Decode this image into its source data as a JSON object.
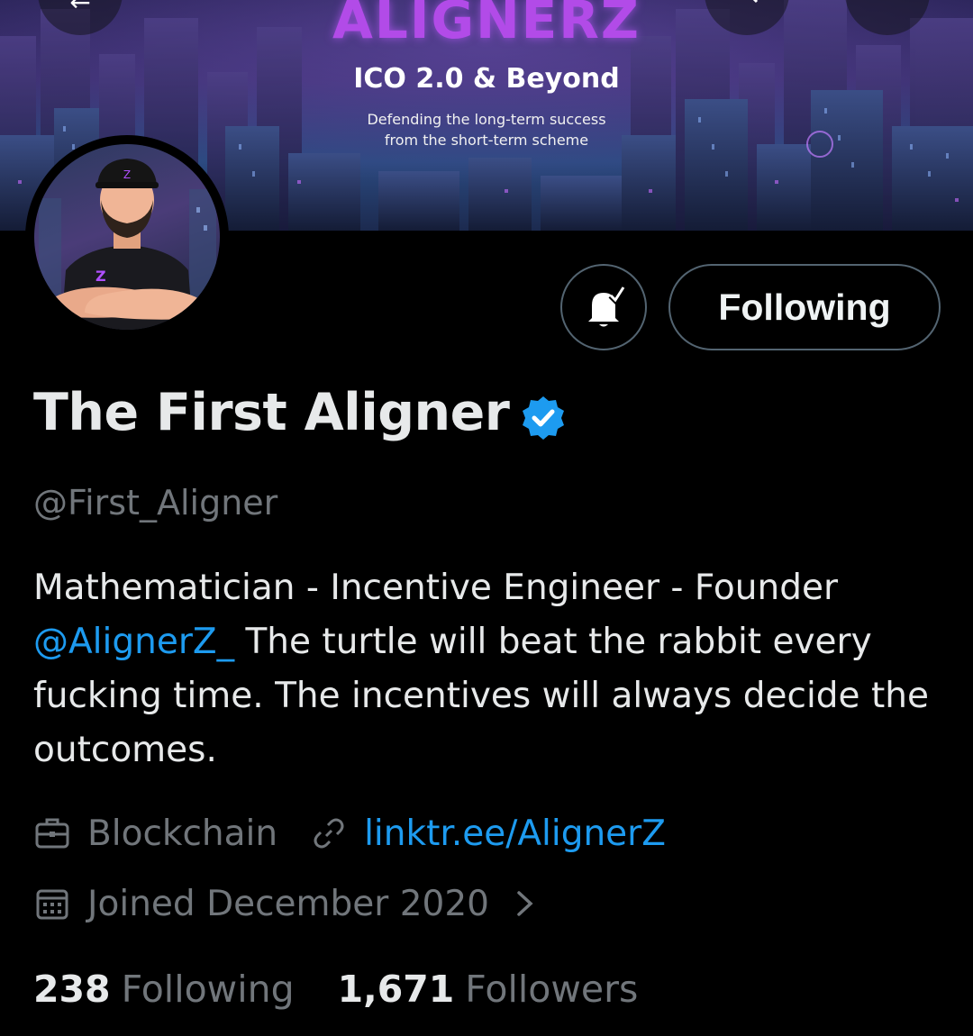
{
  "banner": {
    "logo": "ALIGNERZ",
    "tagline": "ICO 2.0 & Beyond",
    "subtitle_line1": "Defending the long-term success",
    "subtitle_line2": "from the short-term scheme"
  },
  "nav": {
    "back_icon": "arrow-left-icon",
    "search_icon": "search-icon",
    "more_icon": "more-vertical-icon"
  },
  "actions": {
    "notifications_icon": "bell-check-icon",
    "follow_label": "Following"
  },
  "profile": {
    "display_name": "The First Aligner",
    "verified": true,
    "handle": "@First_Aligner",
    "bio_prefix": "Mathematician - Incentive Engineer - Founder",
    "bio_mention": "@AlignerZ_",
    "bio_suffix": " The turtle will beat the rabbit  every fucking time. The incentives will always decide the outcomes.",
    "category": "Blockchain",
    "website": "linktr.ee/AlignerZ",
    "joined": "Joined December 2020"
  },
  "stats": {
    "following_count": "238",
    "following_label": "Following",
    "followers_count": "1,671",
    "followers_label": "Followers"
  },
  "colors": {
    "background": "#000000",
    "text_primary": "#e7e9ea",
    "text_secondary": "#71767b",
    "link": "#1d9bf0",
    "verified_badge": "#1d9bf0",
    "button_border": "#536471"
  }
}
